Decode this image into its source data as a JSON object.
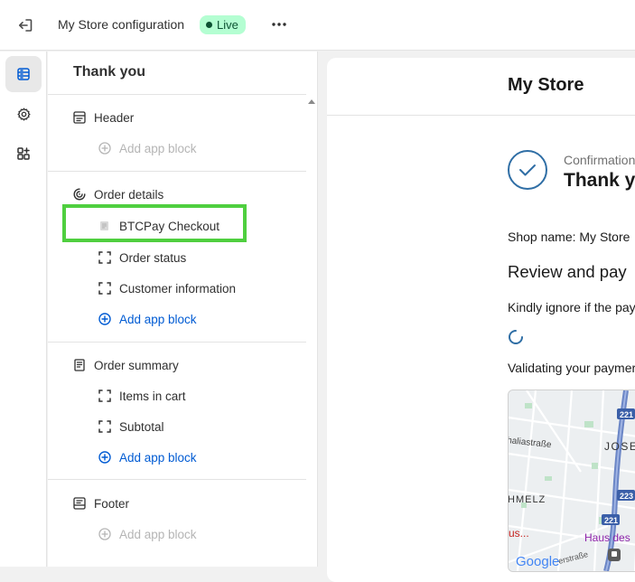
{
  "topbar": {
    "store_title": "My Store configuration",
    "live_label": "Live",
    "exit_icon": "exit-icon",
    "more_icon": "more-horizontal-icon"
  },
  "rail": {
    "items": [
      {
        "icon": "sections-icon",
        "active": true
      },
      {
        "icon": "settings-icon",
        "active": false
      },
      {
        "icon": "apps-icon",
        "active": false
      }
    ]
  },
  "panel": {
    "title": "Thank you",
    "header": {
      "label": "Header",
      "add_block": "Add app block"
    },
    "order_details": {
      "label": "Order details",
      "blocks": [
        "BTCPay Checkout",
        "Order status",
        "Customer information"
      ],
      "add_block": "Add app block"
    },
    "order_summary": {
      "label": "Order summary",
      "blocks": [
        "Items in cart",
        "Subtotal"
      ],
      "add_block": "Add app block"
    },
    "footer": {
      "label": "Footer",
      "add_block": "Add app block"
    }
  },
  "preview": {
    "store_name": "My Store",
    "confirmation_label": "Confirmation",
    "thank_label": "Thank y",
    "shop_name_text": "Shop name: My Store",
    "review_heading": "Review and pay",
    "ignore_text": "Kindly ignore if the pay",
    "validating_text": "Validating your paymer",
    "map_labels": {
      "street_1": "haliastraße",
      "district": "JOSE",
      "area": "HMELZ",
      "poi_1": "us...",
      "poi_2": "Haus des",
      "street_2": "erstraße",
      "google": "Google",
      "road_1": "221",
      "road_2": "223",
      "road_3": "221"
    }
  },
  "colors": {
    "highlight": "#4fcf3f",
    "live_bg": "#b4fed2",
    "link": "#005bd3",
    "check": "#2f6ea5"
  }
}
